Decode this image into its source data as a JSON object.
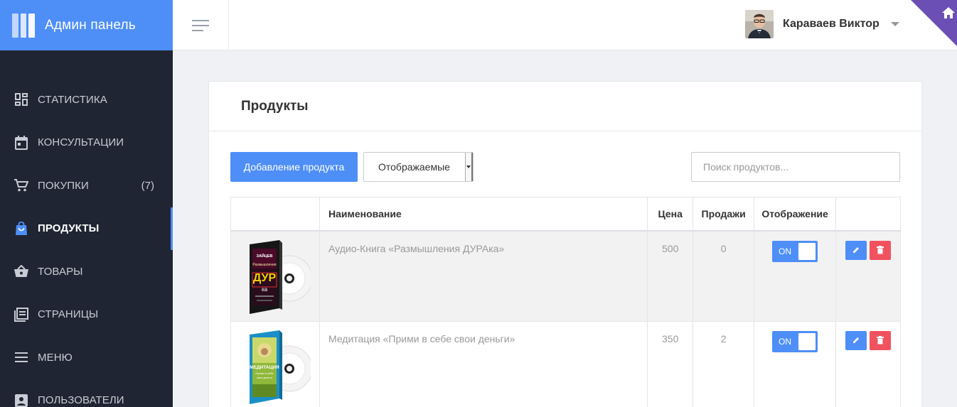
{
  "brand": {
    "title": "Админ панель"
  },
  "sidebar": {
    "items": [
      {
        "label": "СТАТИСТИКА",
        "icon": "dashboard-icon",
        "count": ""
      },
      {
        "label": "КОНСУЛЬТАЦИИ",
        "icon": "calendar-icon",
        "count": ""
      },
      {
        "label": "ПОКУПКИ",
        "icon": "cart-icon",
        "count": "(7)"
      },
      {
        "label": "ПРОДУКТЫ",
        "icon": "shopping-bag-icon",
        "count": "",
        "active": true
      },
      {
        "label": "ТОВАРЫ",
        "icon": "basket-icon",
        "count": ""
      },
      {
        "label": "СТРАНИЦЫ",
        "icon": "pages-icon",
        "count": ""
      },
      {
        "label": "МЕНЮ",
        "icon": "menu-icon",
        "count": ""
      },
      {
        "label": "ПОЛЬЗОВАТЕЛИ",
        "icon": "user-icon",
        "count": ""
      }
    ]
  },
  "header": {
    "user_name": "Караваев Виктор"
  },
  "page": {
    "title": "Продукты",
    "add_button": "Добавление продукта",
    "filter_selected": "Отображаемые",
    "search_placeholder": "Поиск продуктов..."
  },
  "table": {
    "columns": [
      "",
      "Наименование",
      "Цена",
      "Продажи",
      "Отображение",
      ""
    ],
    "rows": [
      {
        "name": "Аудио-Книга «Размышления ДУРАка»",
        "price": "500",
        "sales": "0",
        "display": "ON"
      },
      {
        "name": "Медитация «Прими в себе свои деньги»",
        "price": "350",
        "sales": "2",
        "display": "ON"
      }
    ]
  },
  "colors": {
    "accent": "#4e8ef7",
    "sidebar": "#1f2532",
    "danger": "#f1525f",
    "corner": "#6c4fb5"
  }
}
